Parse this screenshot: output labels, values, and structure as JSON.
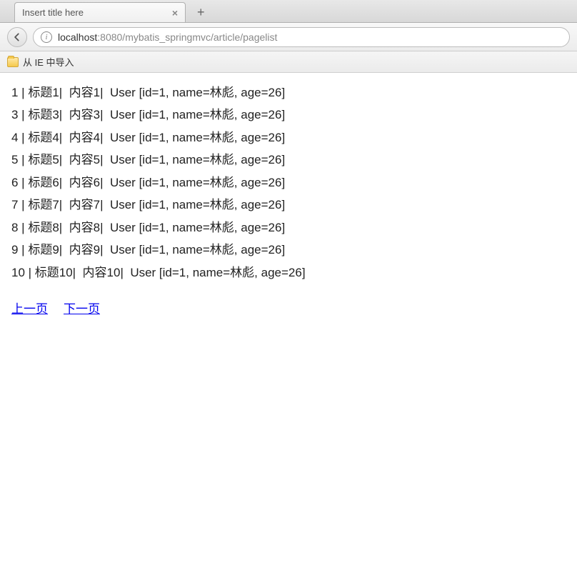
{
  "tab": {
    "title": "Insert title here"
  },
  "url": {
    "host": "localhost",
    "port_and_path": ":8080/mybatis_springmvc/article/pagelist"
  },
  "bookmarks": {
    "item": "从 IE 中导入"
  },
  "rows": [
    {
      "id": "1",
      "title": "标题1",
      "content": "内容1",
      "user": "User [id=1, name=林彪, age=26]"
    },
    {
      "id": "3",
      "title": "标题3",
      "content": "内容3",
      "user": "User [id=1, name=林彪, age=26]"
    },
    {
      "id": "4",
      "title": "标题4",
      "content": "内容4",
      "user": "User [id=1, name=林彪, age=26]"
    },
    {
      "id": "5",
      "title": "标题5",
      "content": "内容5",
      "user": "User [id=1, name=林彪, age=26]"
    },
    {
      "id": "6",
      "title": "标题6",
      "content": "内容6",
      "user": "User [id=1, name=林彪, age=26]"
    },
    {
      "id": "7",
      "title": "标题7",
      "content": "内容7",
      "user": "User [id=1, name=林彪, age=26]"
    },
    {
      "id": "8",
      "title": "标题8",
      "content": "内容8",
      "user": "User [id=1, name=林彪, age=26]"
    },
    {
      "id": "9",
      "title": "标题9",
      "content": "内容9",
      "user": "User [id=1, name=林彪, age=26]"
    },
    {
      "id": "10",
      "title": "标题10",
      "content": "内容10",
      "user": "User [id=1, name=林彪, age=26]"
    }
  ],
  "pagination": {
    "prev": "上一页",
    "next": "下一页"
  }
}
